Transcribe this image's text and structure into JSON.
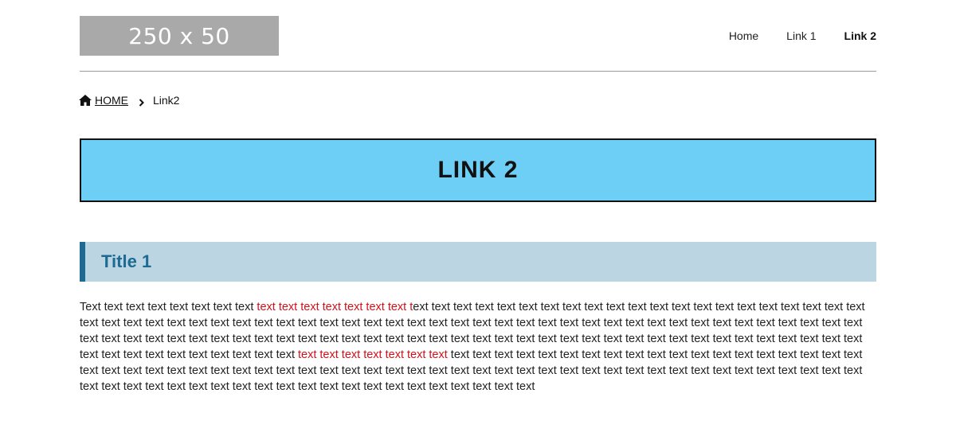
{
  "header": {
    "logo_text": "250 x 50",
    "nav": [
      {
        "label": "Home",
        "active": false
      },
      {
        "label": "Link 1",
        "active": false
      },
      {
        "label": "Link 2",
        "active": true
      }
    ]
  },
  "breadcrumb": {
    "icon": "home-icon",
    "home_label": "HOME",
    "separator_icon": "chevron-right-icon",
    "current_label": "Link2"
  },
  "page": {
    "title": "LINK 2"
  },
  "section": {
    "title": "Title 1"
  },
  "paragraph": {
    "p1": "Text text text text text text text text ",
    "p1_red": "text text text text text text text t",
    "p2": "ext text text text text text text text text text text text text text text text text text text text text text text text text text text text text text text text text text text text text text text text text text text text text text text text text text text text text text text text text text text text text text text text text text text text text text text text text text text text text text text text text text text text text text text text text text text text text text text text text text text text text text text ",
    "p2_red": "text text text text text text text",
    "p3": " text text text text text text text text text text text text text text text text text text text text text text text text text text text text text text text text text text text text text text text text text text text text text text text text text text text text text text text text text text text text text text text text text text text text text text text text text text text text"
  },
  "colors": {
    "accent_blue": "#6ecff6",
    "section_bg": "#bcd5e2",
    "section_accent": "#1d6a93",
    "highlight_red": "#d0121b"
  }
}
